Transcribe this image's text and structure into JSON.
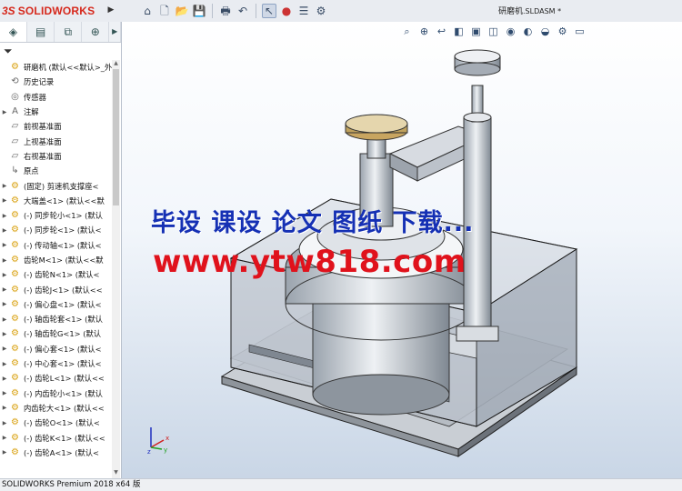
{
  "app": {
    "logo_text": "SOLIDWORKS",
    "logo_prefix": "3S",
    "document_title": "研磨机",
    "document_ext": ".SLDASM *"
  },
  "toolbar": {
    "icons": [
      "home-icon",
      "new-file-icon",
      "open-icon",
      "save-icon",
      "print-icon",
      "undo-icon",
      "select-icon",
      "traffic-light-icon",
      "options-list-icon",
      "settings-icon"
    ]
  },
  "panel": {
    "tabs": [
      "feature-manager",
      "property-manager",
      "configuration-manager",
      "dimxpert-manager",
      "more"
    ],
    "tree": [
      {
        "label": "研磨机  (默认<<默认>_外",
        "type": "root",
        "expand": ""
      },
      {
        "label": "历史记录",
        "type": "history",
        "expand": ""
      },
      {
        "label": "传感器",
        "type": "sensor",
        "expand": ""
      },
      {
        "label": "注解",
        "type": "annotation",
        "expand": "▶"
      },
      {
        "label": "前视基准面",
        "type": "plane",
        "expand": ""
      },
      {
        "label": "上视基准面",
        "type": "plane",
        "expand": ""
      },
      {
        "label": "右视基准面",
        "type": "plane",
        "expand": ""
      },
      {
        "label": "原点",
        "type": "origin",
        "expand": ""
      },
      {
        "label": "(固定) 剪速机支撑座<",
        "type": "part",
        "expand": "▶"
      },
      {
        "label": "大端盖<1> (默认<<默",
        "type": "part",
        "expand": "▶"
      },
      {
        "label": "(-) 同步轮小<1> (默认",
        "type": "part",
        "expand": "▶"
      },
      {
        "label": "(-) 同步轮<1> (默认<",
        "type": "part",
        "expand": "▶"
      },
      {
        "label": "(-) 传动轴<1> (默认<",
        "type": "part",
        "expand": "▶"
      },
      {
        "label": "齿轮M<1> (默认<<默",
        "type": "part",
        "expand": "▶"
      },
      {
        "label": "(-) 齿轮N<1> (默认<",
        "type": "part",
        "expand": "▶"
      },
      {
        "label": "(-) 齿轮J<1> (默认<<",
        "type": "part",
        "expand": "▶"
      },
      {
        "label": "(-) 偏心盘<1> (默认<",
        "type": "part",
        "expand": "▶"
      },
      {
        "label": "(-) 轴齿轮套<1> (默认",
        "type": "part",
        "expand": "▶"
      },
      {
        "label": "(-) 轴齿轮G<1> (默认",
        "type": "part",
        "expand": "▶"
      },
      {
        "label": "(-) 偏心套<1> (默认<",
        "type": "part",
        "expand": "▶"
      },
      {
        "label": "(-) 中心套<1> (默认<",
        "type": "part",
        "expand": "▶"
      },
      {
        "label": "(-) 齿轮L<1> (默认<<",
        "type": "part",
        "expand": "▶"
      },
      {
        "label": "(-) 内齿轮小<1> (默认",
        "type": "part",
        "expand": "▶"
      },
      {
        "label": "内齿轮大<1> (默认<<",
        "type": "part",
        "expand": "▶"
      },
      {
        "label": "(-) 齿轮O<1> (默认<",
        "type": "part",
        "expand": "▶"
      },
      {
        "label": "(-) 齿轮K<1> (默认<<",
        "type": "part",
        "expand": "▶"
      },
      {
        "label": "(-) 齿轮A<1> (默认<",
        "type": "part",
        "expand": "▶"
      }
    ]
  },
  "viewport": {
    "heads_up_icons": [
      "zoom-fit-icon",
      "zoom-area-icon",
      "previous-view-icon",
      "section-view-icon",
      "view-orientation-icon",
      "display-style-icon",
      "hide-show-icon",
      "edit-appearance-icon",
      "apply-scene-icon",
      "view-settings-icon",
      "display-monitor-icon"
    ],
    "watermark_line1": "毕设 课设 论文 图纸 下载...",
    "watermark_line2": "www.ytw818.com",
    "axis_labels": {
      "x": "x",
      "y": "y",
      "z": "z"
    }
  },
  "statusbar": {
    "text": "SOLIDWORKS Premium 2018 x64 版"
  },
  "colors": {
    "accent": "#d6281c",
    "watermark_blue": "#1530b4",
    "watermark_red": "#e0121c"
  }
}
